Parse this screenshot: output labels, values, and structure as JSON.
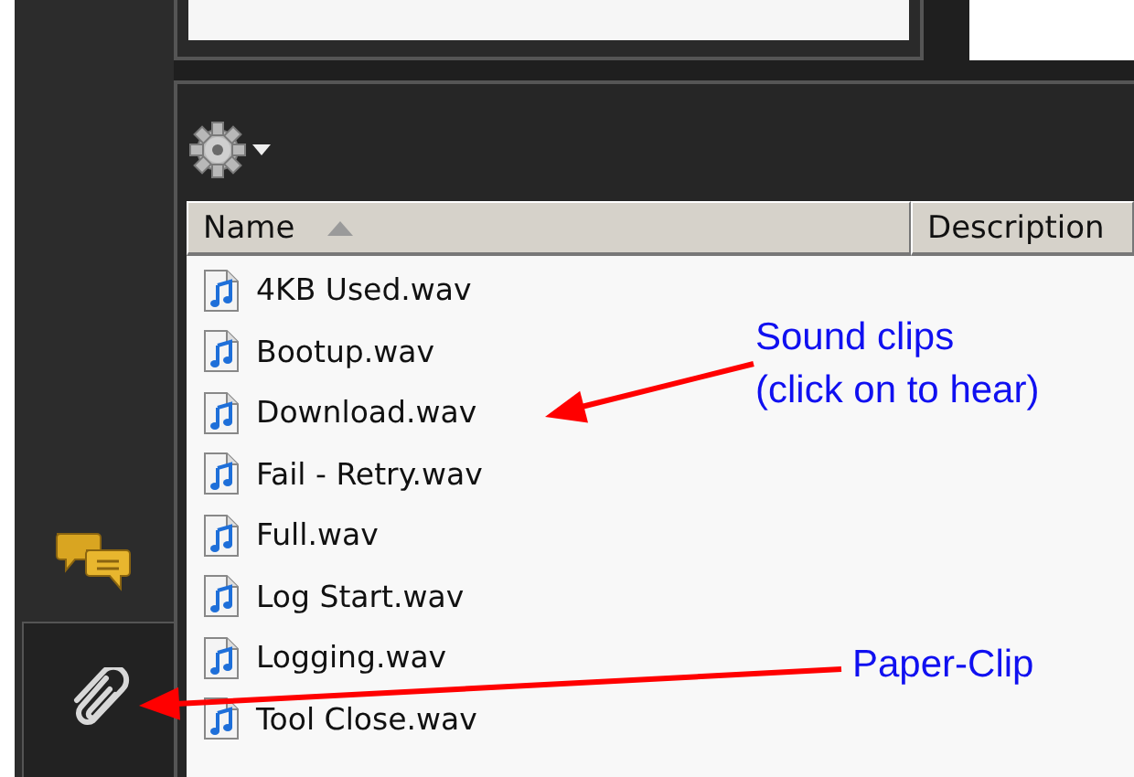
{
  "sidebar_buttons": [
    {
      "kind": "comments",
      "selected": false
    },
    {
      "kind": "attachments",
      "selected": true
    }
  ],
  "columns": [
    {
      "label": "Name",
      "sorted": true
    },
    {
      "label": "Description",
      "sorted": false
    }
  ],
  "files": [
    "4KB Used.wav",
    "Bootup.wav",
    "Download.wav",
    "Fail - Retry.wav",
    "Full.wav",
    "Log Start.wav",
    "Logging.wav",
    "Tool Close.wav"
  ],
  "annotations": [
    {
      "text": "Sound clips\n(click on to hear)"
    },
    {
      "text": "Paper-Clip"
    }
  ]
}
